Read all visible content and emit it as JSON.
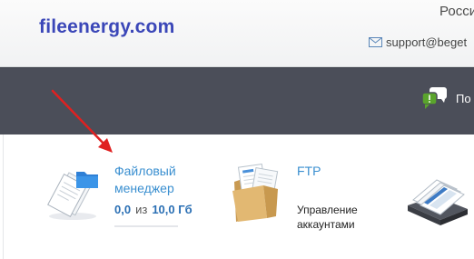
{
  "header": {
    "brand": "fileenergy.com",
    "country": "Росси",
    "support_email": "support@beget"
  },
  "nav": {
    "chat_label": "По"
  },
  "tiles": {
    "file_manager": {
      "title_line1": "Файловый",
      "title_line2": "менеджер",
      "used": "0,0",
      "of_label": "из",
      "total": "10,0 Гб",
      "usage_fraction": 0.0
    },
    "ftp": {
      "title": "FTP",
      "sub_line1": "Управление",
      "sub_line2": "аккаунтами"
    }
  },
  "colors": {
    "brand": "#3b47b8",
    "nav_band": "#4b4e59",
    "link_blue": "#3a8fd0",
    "usage_blue": "#2a6fb4",
    "annotation_arrow": "#e02020"
  },
  "icons": {
    "support": "mail-icon",
    "chat": "chat-bubbles-icon",
    "file_manager": "file-manager-icon",
    "ftp": "ftp-folder-icon",
    "third_tile": "accounts-tray-icon"
  }
}
